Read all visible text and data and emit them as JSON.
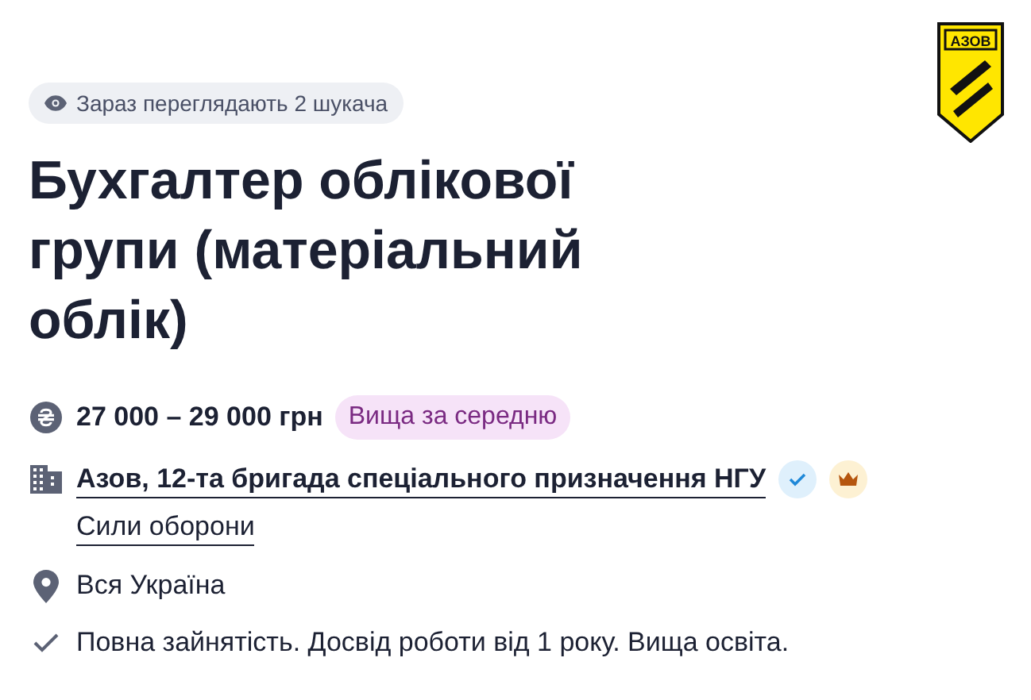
{
  "logo": {
    "text": "АЗОВ"
  },
  "viewers_badge": "Зараз переглядають 2 шукача",
  "title": "Бухгалтер облікової групи (матеріальний облік)",
  "details": [
    {
      "kind": "salary",
      "text": "27 000 – 29 000 грн",
      "tag": "Вища за середню"
    },
    {
      "kind": "company",
      "text": "Азов, 12-та бригада спеціального призначення НГУ",
      "verified": true,
      "premium": true,
      "subtext": "Сили оборони"
    },
    {
      "kind": "location",
      "text": "Вся Україна"
    },
    {
      "kind": "requirements",
      "text": "Повна зайнятість. Досвід роботи від 1 року. Вища освіта."
    }
  ]
}
